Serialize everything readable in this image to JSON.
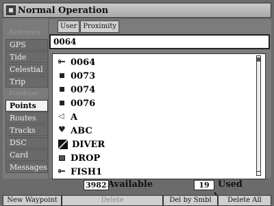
{
  "window": {
    "title": "Normal Operation"
  },
  "sidebar": {
    "items": [
      {
        "label": "Reference",
        "type": "header"
      },
      {
        "label": "GPS",
        "type": "item"
      },
      {
        "label": "Tide",
        "type": "item"
      },
      {
        "label": "Celestial",
        "type": "item"
      },
      {
        "label": "Trip",
        "type": "item"
      },
      {
        "label": "Database",
        "type": "header"
      },
      {
        "label": "Points",
        "type": "item",
        "selected": true
      },
      {
        "label": "Routes",
        "type": "item"
      },
      {
        "label": "Tracks",
        "type": "item"
      },
      {
        "label": "DSC",
        "type": "item"
      },
      {
        "label": "Card",
        "type": "item"
      },
      {
        "label": "Messages",
        "type": "item"
      }
    ]
  },
  "main": {
    "tabs": [
      {
        "label": "User"
      },
      {
        "label": "Proximity"
      }
    ],
    "search_value": "0064",
    "waypoints": [
      {
        "name": "0064",
        "icon": "flag-icon"
      },
      {
        "name": "0073",
        "icon": "square-icon"
      },
      {
        "name": "0074",
        "icon": "square-icon"
      },
      {
        "name": "0076",
        "icon": "square-icon"
      },
      {
        "name": "A",
        "icon": "anchor-icon"
      },
      {
        "name": "ABC",
        "icon": "heart-icon"
      },
      {
        "name": "DIVER",
        "icon": "diver-flag-icon"
      },
      {
        "name": "DROP",
        "icon": "drop-icon"
      },
      {
        "name": "FISH1",
        "icon": "flag-icon"
      }
    ]
  },
  "status": {
    "available_count": "3982",
    "available_label": "Available",
    "used_count": "19",
    "used_label": "Used"
  },
  "softkeys": [
    {
      "label": "New Waypoint",
      "enabled": true
    },
    {
      "label": "Delete",
      "enabled": false
    },
    {
      "label": "Del by Smbl",
      "enabled": true
    },
    {
      "label": "Delete All",
      "enabled": true
    }
  ],
  "colors": {
    "background": "#6b6b6b",
    "list_background": "#ffffff",
    "selected_item": "#f2f2f2"
  }
}
